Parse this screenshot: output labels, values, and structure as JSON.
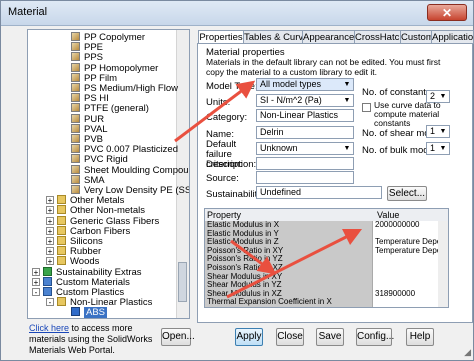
{
  "window": {
    "title": "Material",
    "close_label": "✕"
  },
  "tree": {
    "items": [
      {
        "label": "PP Copolymer",
        "icon": "mat",
        "indent": 2
      },
      {
        "label": "PPE",
        "icon": "mat",
        "indent": 2
      },
      {
        "label": "PPS",
        "icon": "mat",
        "indent": 2
      },
      {
        "label": "PP Homopolymer",
        "icon": "mat",
        "indent": 2
      },
      {
        "label": "PP Film",
        "icon": "mat",
        "indent": 2
      },
      {
        "label": "PS Medium/High Flow",
        "icon": "mat",
        "indent": 2
      },
      {
        "label": "PS HI",
        "icon": "mat",
        "indent": 2
      },
      {
        "label": "PTFE (general)",
        "icon": "mat",
        "indent": 2
      },
      {
        "label": "PUR",
        "icon": "mat",
        "indent": 2
      },
      {
        "label": "PVAL",
        "icon": "mat",
        "indent": 2
      },
      {
        "label": "PVB",
        "icon": "mat",
        "indent": 2
      },
      {
        "label": "PVC 0.007 Plasticized",
        "icon": "mat",
        "indent": 2
      },
      {
        "label": "PVC Rigid",
        "icon": "mat",
        "indent": 2
      },
      {
        "label": "Sheet Moulding Compound",
        "icon": "mat",
        "indent": 2
      },
      {
        "label": "SMA",
        "icon": "mat",
        "indent": 2
      },
      {
        "label": "Very Low Density PE (SS)",
        "icon": "mat",
        "indent": 2
      },
      {
        "label": "Other Metals",
        "icon": "folder",
        "indent": 1,
        "expander": "+"
      },
      {
        "label": "Other Non-metals",
        "icon": "folder",
        "indent": 1,
        "expander": "+"
      },
      {
        "label": "Generic Glass Fibers",
        "icon": "folder",
        "indent": 1,
        "expander": "+"
      },
      {
        "label": "Carbon Fibers",
        "icon": "folder",
        "indent": 1,
        "expander": "+"
      },
      {
        "label": "Silicons",
        "icon": "folder",
        "indent": 1,
        "expander": "+"
      },
      {
        "label": "Rubber",
        "icon": "folder",
        "indent": 1,
        "expander": "+"
      },
      {
        "label": "Woods",
        "icon": "folder",
        "indent": 1,
        "expander": "+"
      },
      {
        "label": "Sustainability Extras",
        "icon": "lib",
        "indent": 0,
        "expander": "+"
      },
      {
        "label": "Custom Materials",
        "icon": "custom",
        "indent": 0,
        "expander": "+"
      },
      {
        "label": "Custom Plastics",
        "icon": "custom",
        "indent": 0,
        "expander": "-"
      },
      {
        "label": "Non-Linear Plastics",
        "icon": "folder",
        "indent": 1,
        "expander": "-"
      },
      {
        "label": "ABS",
        "icon": "abs",
        "indent": 2,
        "selected": true
      }
    ]
  },
  "footer": {
    "link_text": "Click here",
    "note_text": " to access more materials using the SolidWorks Materials Web Portal.",
    "open_label": "Open...",
    "apply_label": "Apply",
    "close_label": "Close",
    "save_label": "Save",
    "config_label": "Config...",
    "help_label": "Help"
  },
  "tabs": [
    "Properties",
    "Tables & Curves",
    "Appearance",
    "CrossHatch",
    "Custom",
    "Application Data"
  ],
  "properties": {
    "header": "Material properties",
    "notice": "Materials in the default library can not be edited. You must first copy the material to a custom library to edit it.",
    "model_type_label": "Model Type:",
    "model_type_value": "All model types",
    "units_label": "Units:",
    "units_value": "SI - N/m^2 (Pa)",
    "category_label": "Category:",
    "category_value": "Non-Linear Plastics",
    "name_label": "Name:",
    "name_value": "Delrin",
    "failure_label": "Default failure criterion:",
    "failure_value": "Unknown",
    "description_label": "Description:",
    "description_value": "",
    "source_label": "Source:",
    "source_value": "",
    "sustainability_label": "Sustainability:",
    "sustainability_value": "Undefined",
    "select_label": "Select...",
    "constants_label": "No. of constants:",
    "constants_value": "2",
    "curve_label": "Use curve data to compute material constants",
    "shear_label": "No. of shear moduli:",
    "shear_value": "1",
    "bulk_label": "No. of bulk moduli:",
    "bulk_value": "1"
  },
  "grid": {
    "col_property": "Property",
    "col_value": "Value",
    "rows": [
      {
        "property": "Elastic Modulus in X",
        "value": "2000000000"
      },
      {
        "property": "Elastic Modulus in Y",
        "value": ""
      },
      {
        "property": "Elastic Modulus in Z",
        "value": "Temperature Dependent"
      },
      {
        "property": "Poisson's Ratio in XY",
        "value": "Temperature Dependent"
      },
      {
        "property": "Poisson's Ratio in YZ",
        "value": ""
      },
      {
        "property": "Poisson's Ratio in XZ",
        "value": ""
      },
      {
        "property": "Shear Modulus in XY",
        "value": ""
      },
      {
        "property": "Shear Modulus in YZ",
        "value": ""
      },
      {
        "property": "Shear Modulus in XZ",
        "value": "318900000"
      },
      {
        "property": "Thermal Expansion Coefficient in X",
        "value": ""
      }
    ]
  },
  "colors": {
    "annotation_arrow": "#e9503f",
    "selection": "#3a72c4"
  }
}
